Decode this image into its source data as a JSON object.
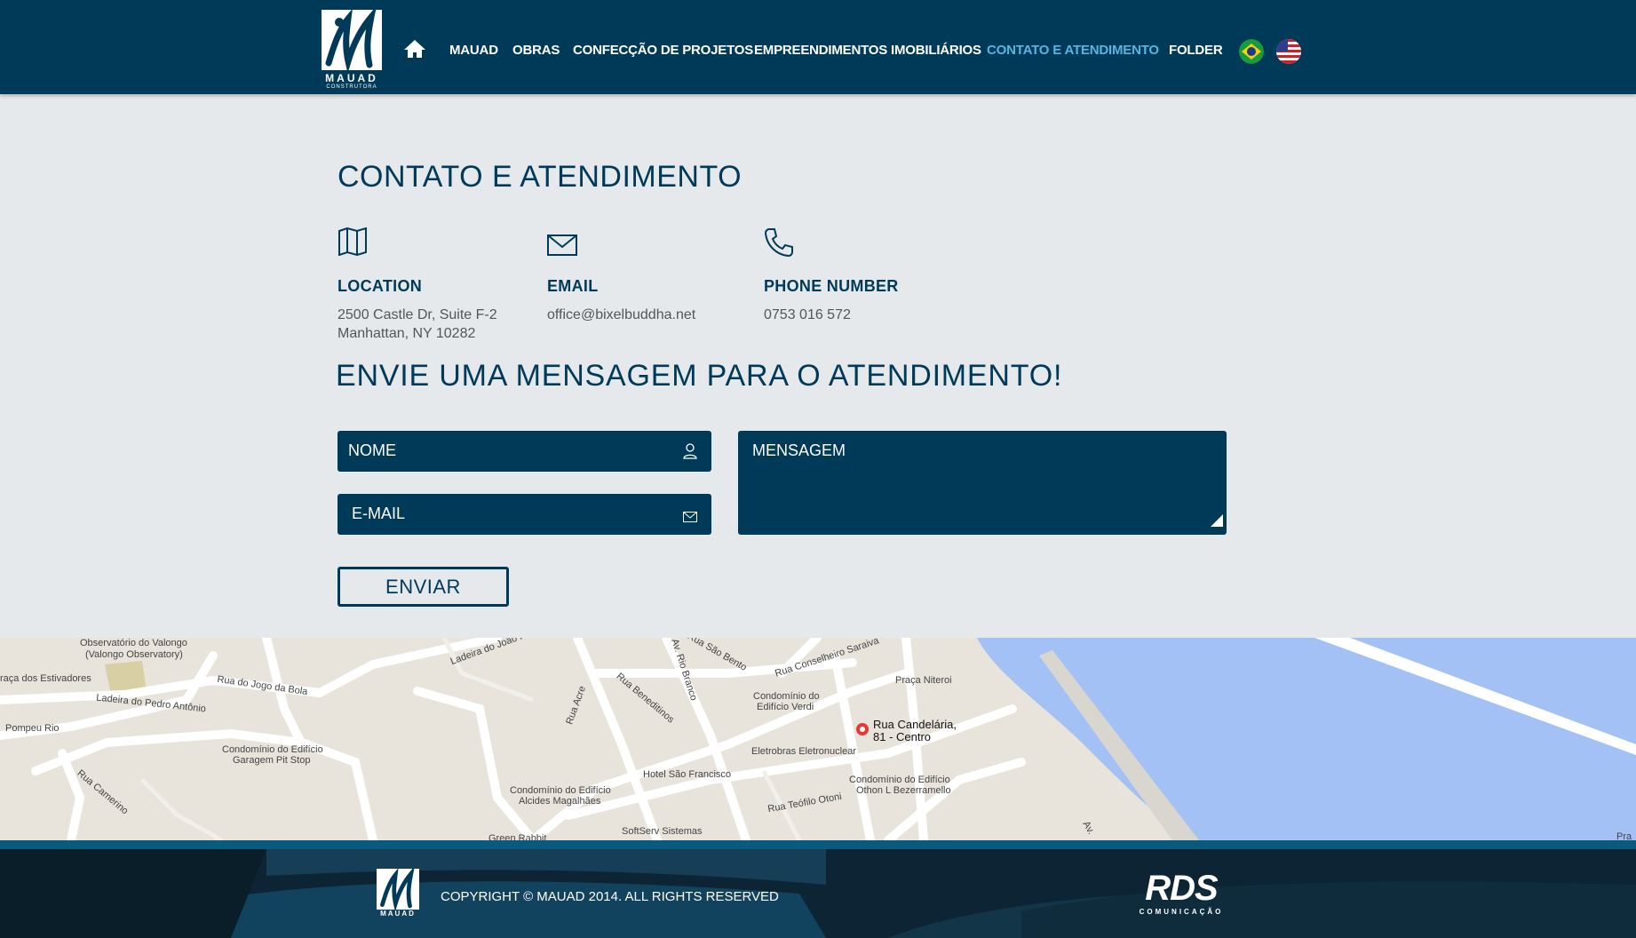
{
  "header": {
    "logo_text": "MAUAD",
    "logo_subtext": "CONSTRUTORA",
    "nav": [
      {
        "label": "MAUAD"
      },
      {
        "label": "OBRAS"
      },
      {
        "label": "CONFECÇÃO DE PROJETOS"
      },
      {
        "label": "EMPREENDIMENTOS IMOBILIÁRIOS"
      },
      {
        "label": "CONTATO E ATENDIMENTO"
      },
      {
        "label": "FOLDER"
      }
    ],
    "active_color": "#5ab4e2",
    "brand_color": "#003a59"
  },
  "page_title": "CONTATO E ATENDIMENTO",
  "info": {
    "location": {
      "title": "LOCATION",
      "line1": "2500 Castle Dr, Suite F-2",
      "line2": "Manhattan, NY 10282"
    },
    "email": {
      "title": "EMAIL",
      "value": "office@bixelbuddha.net"
    },
    "phone": {
      "title": "PHONE NUMBER",
      "value": "0753 016 572"
    }
  },
  "form": {
    "title": "ENVIE UMA MENSAGEM PARA O ATENDIMENTO!",
    "name_placeholder": "NOME",
    "email_placeholder": "E-MAIL",
    "message_placeholder": "MENSAGEM",
    "submit_label": "ENVIAR"
  },
  "map": {
    "labels": [
      "Observatório do Valongo",
      "(Valongo Observatory)",
      "raça dos Estivadores",
      "Rua do Jogo da Bola",
      "Ladeira do Pedro Antônio",
      "Pompeu Rio",
      "Condomínio do Edifício",
      "Garagem Pit Stop",
      "Rua Camerino",
      "Ladeira do João H",
      "Rua Acre",
      "Rua Beneditinos",
      "Av. Rio Branco",
      "Rua São Bento",
      "Rua Conselheiro Saraiva",
      "Condomínio do",
      "Edifício Verdi",
      "Praça Niteroi",
      "Rua Candelária,",
      "81 - Centro",
      "Eletrobras Eletronuclear",
      "Hotel São Francisco",
      "Condomínio do Edifício",
      "Alcides Magalhães",
      "Condomínio do Edifício",
      "Othon L Bezerramello",
      "Rua Teófilo Otoni",
      "SoftServ Sistemas",
      "Green Rabbit",
      "Av.",
      "Pra"
    ]
  },
  "footer": {
    "copyright": "COPYRIGHT © MAUAD 2014. ALL RIGHTS RESERVED",
    "partner_logo": "RDS",
    "partner_sub": "COMUNICAÇÃO"
  }
}
